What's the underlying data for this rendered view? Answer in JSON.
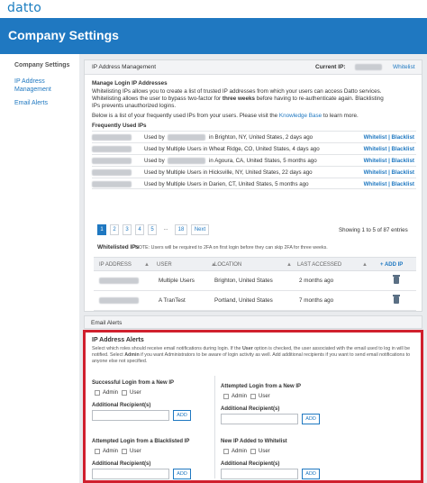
{
  "app": {
    "logo": "datto",
    "page_title": "Company Settings"
  },
  "sidebar": {
    "title": "Company Settings",
    "items": [
      {
        "label": "IP Address Management"
      },
      {
        "label": "Email Alerts"
      }
    ]
  },
  "ip_panel": {
    "title": "IP Address Management",
    "current_ip_label": "Current IP:",
    "whitelist_link": "Whitelist",
    "manage_heading": "Manage Login IP Addresses",
    "desc_line1": "Whitelisting IPs allows you to create a list of trusted IP addresses from which your users can access Datto services.",
    "desc_line2a": "Whitelisting allows the user to bypass two-factor for ",
    "desc_line2b": "three weeks",
    "desc_line2c": " before having to re-authenticate again. Blacklisting",
    "desc_line3": "IPs prevents unauthorized logins.",
    "kb_prefix": "Below is a list of your frequently used IPs from your users. Please visit the ",
    "kb_link": "Knowledge Base",
    "kb_suffix": " to learn more.",
    "frequent_title": "Frequently Used IPs",
    "frequent_rows": [
      {
        "used": "Used by",
        "rest": "in Brighton, NY, United States, 2 days ago",
        "action": "Whitelist | Blacklist"
      },
      {
        "used": "Used by Multiple Users in Wheat Ridge, CO, United States, 4 days ago",
        "rest": "",
        "action": "Whitelist | Blacklist"
      },
      {
        "used": "Used by",
        "rest": "in Agoura, CA, United States, 5 months ago",
        "action": "Whitelist | Blacklist"
      },
      {
        "used": "Used by Multiple Users in Hicksville, NY, United States, 22 days ago",
        "rest": "",
        "action": "Whitelist | Blacklist"
      },
      {
        "used": "Used by Multiple Users in Darien, CT, United States, 5 months ago",
        "rest": "",
        "action": "Whitelist | Blacklist"
      }
    ],
    "pager": [
      "1",
      "2",
      "3",
      "4",
      "5",
      "...",
      "18",
      "Next"
    ],
    "showing": "Showing 1 to 5 of 87 entries",
    "whitelisted_title": "Whitelisted IPs",
    "whitelisted_note": "NOTE: Users will be required to 2FA on first login before they can skip 2FA for three weeks.",
    "table_headers": [
      "IP ADDRESS",
      "USER",
      "LOCATION",
      "LAST ACCESSED",
      "+ ADD IP"
    ],
    "table_rows": [
      {
        "user": "Multiple Users",
        "location": "Brighton, United States",
        "last": "2 months ago"
      },
      {
        "user": "A TranTest",
        "location": "Portland, United States",
        "last": "7 months ago"
      }
    ]
  },
  "email_alerts": {
    "header": "Email Alerts",
    "title": "IP Address Alerts",
    "desc_a": "Select which roles should receive email notifications during login. If the ",
    "desc_user": "User",
    "desc_b": " option is checked, the user associated with the email used to log in will be notified. Select ",
    "desc_admin": "Admin",
    "desc_c": " if you want Administrators to be aware of login activity as well. Add additional recipients if you want to send email notifications to anyone else not specified.",
    "admin_label": "Admin",
    "user_label": "User",
    "recipients_label": "Additional Recipient(s)",
    "add_label": "ADD",
    "sections": [
      "Successful Login from a New IP",
      "Attempted Login from a New IP",
      "Attempted Login from a Blacklisted IP",
      "New  IP Added to Whitelist"
    ]
  }
}
